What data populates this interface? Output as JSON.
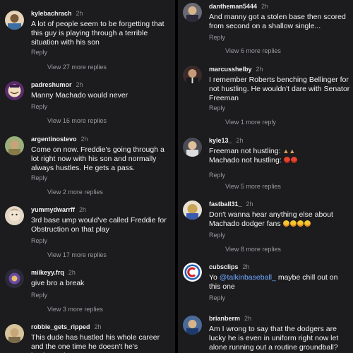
{
  "left": [
    {
      "user": "kylebachrach",
      "time": "2h",
      "text": "A lot of people seem to be forgetting that this guy is playing through a terrible situation with his son",
      "reply": "Reply",
      "more": "View 27 more replies"
    },
    {
      "user": "padreshumor",
      "time": "2h",
      "text": "Manny Machado would never",
      "reply": "Reply",
      "more": "View 16 more replies"
    },
    {
      "user": "argentinostevo",
      "time": "2h",
      "text": "Come on now. Freddie's going through a lot right now with his son and normally always hustles. He gets a pass.",
      "reply": "Reply",
      "more": "View 2 more replies"
    },
    {
      "user": "yummydwarrff",
      "time": "2h",
      "text": "3rd base ump would've called Freddie for Obstruction on that play",
      "reply": "Reply",
      "more": "View 17 more replies"
    },
    {
      "user": "miikeyy.frq",
      "time": "2h",
      "text": "give bro a break",
      "reply": "Reply",
      "more": "View 3 more replies"
    },
    {
      "user": "robbie_gets_ripped",
      "time": "2h",
      "text": "This dude has hustled his whole career and the one time he doesn't he's lambasted..."
    }
  ],
  "right": [
    {
      "user": "dantheman5444",
      "time": "2h",
      "text": "And manny got a stolen base then scored from second on a shallow single...",
      "reply": "Reply",
      "more": "View 6 more replies"
    },
    {
      "user": "marcusshelby",
      "time": "2h",
      "text": "I remember Roberts benching Bellinger for not hustling. He wouldn't dare with Senator Freeman",
      "reply": "Reply",
      "more": "View 1 more reply"
    },
    {
      "user": "kyle13_",
      "time": "2h",
      "line1": "Freeman not hustling:",
      "line2": "Machado not hustling:",
      "reply": "Reply",
      "more": "View 5 more replies"
    },
    {
      "user": "fastball31_",
      "time": "2h",
      "text": "Don't wanna hear anything else about Machado dodger fans",
      "reply": "Reply",
      "more": "View 8 more replies"
    },
    {
      "user": "cubsclips",
      "time": "2h",
      "mention": "@talkinbaseball_",
      "text": " maybe chill out on this one",
      "reply": "Reply"
    },
    {
      "user": "brianberm",
      "time": "2h",
      "text": "Am I wrong to say that the dodgers are lucky he is even in uniform right now let alone running out a routine groundball?"
    }
  ],
  "icons": {
    "avatar_colors": [
      "#7a5a3a",
      "#5b2a6b",
      "#8a7a4a",
      "#b9a88a",
      "#2c2a3a",
      "#c7a77a",
      "#3a2a2a",
      "#4b4b55",
      "#a88a6a",
      "#c9a455",
      "#1f5fb8",
      "#4a6a9a"
    ]
  }
}
